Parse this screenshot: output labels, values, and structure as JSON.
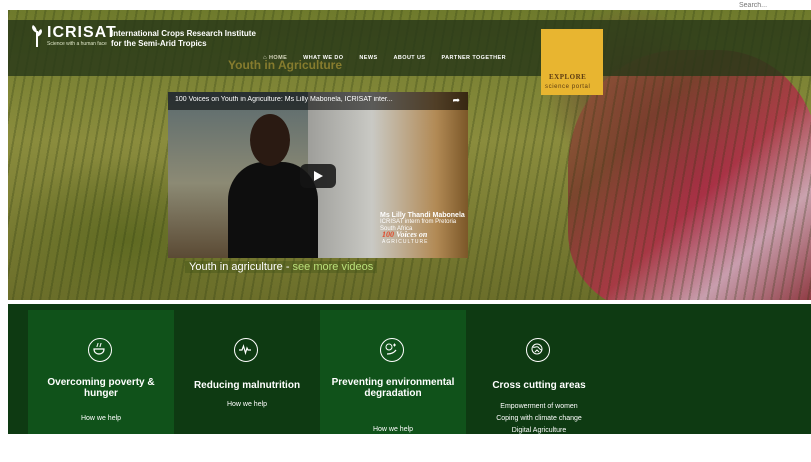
{
  "search": {
    "placeholder": "Search..."
  },
  "header": {
    "logo_name": "ICRISAT",
    "logo_tagline": "Science with a human face",
    "org_line1": "International Crops Research Institute",
    "org_line2": "for the Semi-Arid Tropics",
    "nav": [
      "HOME",
      "WHAT WE DO",
      "NEWS",
      "ABOUT US",
      "PARTNER TOGETHER"
    ],
    "explore_line1": "EXPLORE",
    "explore_line2": "science portal",
    "ghost_title": "Youth in Agriculture"
  },
  "video": {
    "title": "100 Voices on Youth in Agriculture: Ms Lilly Mabonela, ICRISAT inter...",
    "lower_third_name": "Ms Lilly Thandi Mabonela",
    "lower_third_line2": "ICRISAT intern from Pretoria",
    "lower_third_line3": "South Africa",
    "brand_num": "100",
    "brand_word": "Voices on",
    "brand_sub": "AGRICULTURE"
  },
  "caption": {
    "text": "Youth in agriculture - ",
    "link": "see more videos"
  },
  "panels": [
    {
      "icon": "bowl-icon",
      "title": "Overcoming poverty & hunger",
      "links": [
        "How we help"
      ]
    },
    {
      "icon": "pulse-icon",
      "title": "Reducing malnutrition",
      "links": [
        "How we help"
      ]
    },
    {
      "icon": "leaf-cloud-icon",
      "title": "Preventing environmental degradation",
      "links": [
        "How we help"
      ]
    },
    {
      "icon": "globe-icon",
      "title": "Cross cutting areas",
      "links": [
        "Empowerment of women",
        "Coping with climate change",
        "Digital Agriculture"
      ]
    }
  ],
  "colors": {
    "header_bg": "#283818",
    "explore_bg": "#e8b530",
    "panel_dark": "#0e3a12",
    "panel_light": "#10521a",
    "link_accent": "#b9e07a"
  }
}
